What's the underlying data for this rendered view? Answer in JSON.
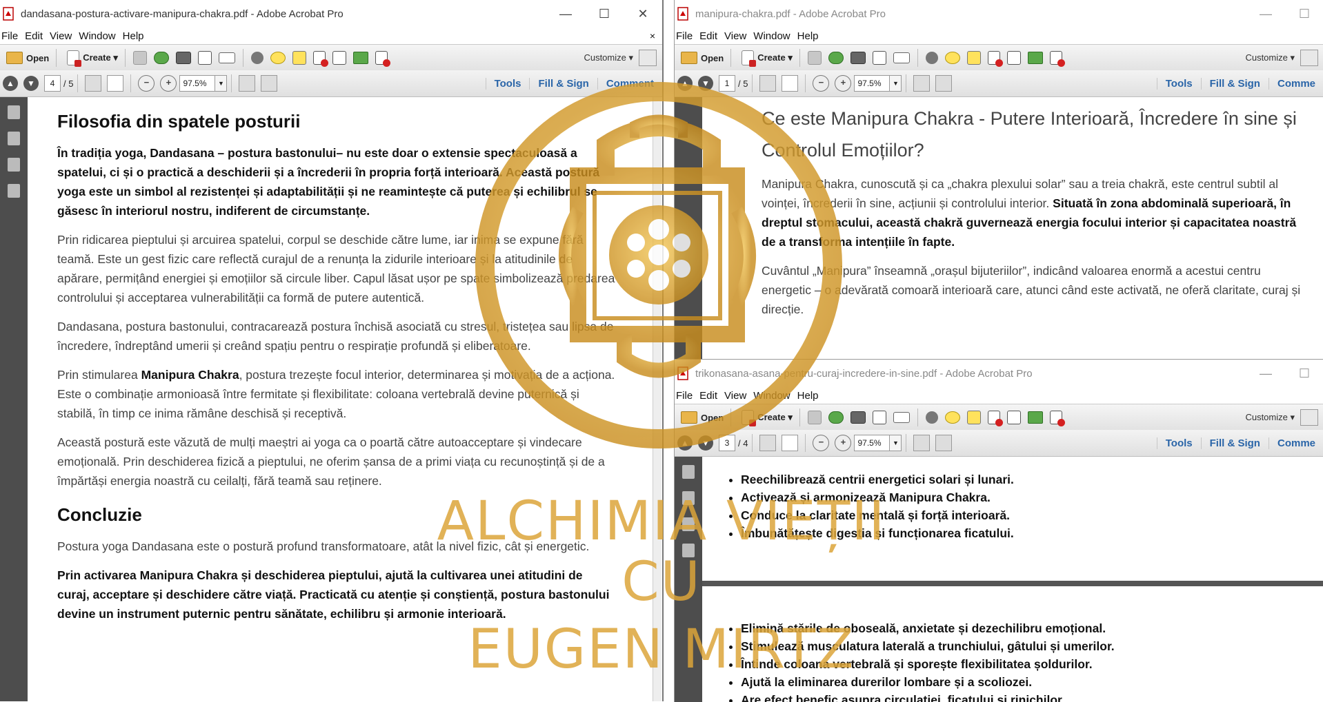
{
  "window_left": {
    "title": "dandasana-postura-activare-manipura-chakra.pdf - Adobe Acrobat Pro",
    "minimize": "—",
    "maximize": "☐",
    "close": "✕",
    "menu": [
      "File",
      "Edit",
      "View",
      "Window",
      "Help"
    ],
    "menu_close": "×",
    "toolbar": {
      "open_label": "Open",
      "create_label": "Create ▾",
      "customize_label": "Customize ▾"
    },
    "nav": {
      "page": "4",
      "of": "/ 5",
      "zoom": "97.5%"
    },
    "tabs": [
      "Tools",
      "Fill & Sign",
      "Comment"
    ],
    "content": {
      "heading1": "Filosofia din spatele posturii",
      "p1": "În tradiția yoga, Dandasana – postura bastonului– nu este doar o extensie spectaculoasă a spatelui, ci și o practică a deschiderii și a încrederii în propria forță interioară. Această postură yoga este un simbol al rezistenței și adaptabilității și ne reamintește că puterea și echilibrul se găsesc în interiorul nostru, indiferent de circumstanțe.",
      "p2": "Prin ridicarea pieptului și arcuirea spatelui, corpul se deschide către lume, iar inima se expune fără teamă. Este un gest fizic care reflectă curajul de a renunța la zidurile interioare și la atitudinile de apărare, permițând energiei și emoțiilor să circule liber. Capul lăsat ușor pe spate simbolizează predarea controlului și acceptarea vulnerabilității ca formă de putere autentică.",
      "p3": "Dandasana, postura bastonului, contracarează postura închisă asociată cu stresul, tristețea sau lipsa de încredere, îndreptând umerii și creând spațiu pentru o respirație profundă și eliberatoare.",
      "p4_a": "Prin stimularea ",
      "p4_b": "Manipura Chakra",
      "p4_c": ", postura trezește focul interior, determinarea și motivația de a acționa. Este o combinație armonioasă între fermitate și flexibilitate: coloana vertebrală devine puternică și stabilă, în timp ce inima rămâne deschisă și receptivă.",
      "p5": "Această postură este văzută de mulți maeștri ai yoga ca o poartă către autoacceptare și vindecare emoțională. Prin deschiderea fizică a pieptului, ne oferim șansa de a primi viața cu recunoștință și de a împărtăși energia noastră cu ceilalți, fără teamă sau reținere.",
      "heading2": "Concluzie",
      "p6": "Postura yoga Dandasana este o postură profund transformatoare, atât la nivel fizic, cât și energetic.",
      "p7": "Prin activarea Manipura Chakra și deschiderea pieptului, ajută la cultivarea unei atitudini de curaj, acceptare și deschidere către viață. Practicată cu atenție și conștiență, postura bastonului devine un instrument puternic pentru sănătate, echilibru și armonie interioară."
    }
  },
  "window_top_right": {
    "title": "manipura-chakra.pdf - Adobe Acrobat Pro",
    "minimize": "—",
    "maximize": "☐",
    "menu": [
      "File",
      "Edit",
      "View",
      "Window",
      "Help"
    ],
    "toolbar": {
      "open_label": "Open",
      "create_label": "Create ▾",
      "customize_label": "Customize ▾"
    },
    "nav": {
      "page": "1",
      "of": "/ 5",
      "zoom": "97.5%"
    },
    "tabs": [
      "Tools",
      "Fill & Sign",
      "Comme"
    ],
    "content": {
      "heading": "Ce este Manipura Chakra - Putere Interioară, Încredere în sine și Controlul Emoțiilor?",
      "p1_a": "Manipura Chakra, cunoscută și ca „chakra plexului solar” sau a treia chakră, este centrul subtil al voinței, încrederii în sine, acțiunii și controlului interior. ",
      "p1_b": "Situată în zona abdominală superioară, în dreptul stomacului, această chakră guvernează energia focului interior și capacitatea noastră de a transforma intențiile în fapte.",
      "p2": "Cuvântul „Manipura” înseamnă „orașul bijuteriilor”, indicând valoarea enormă a acestui centru energetic – o adevărată comoară interioară care, atunci când este activată, ne oferă claritate, curaj și direcție."
    }
  },
  "window_bottom_right": {
    "title": "trikonasana-asana-pentru-curaj-incredere-in-sine.pdf - Adobe Acrobat Pro",
    "minimize": "—",
    "maximize": "☐",
    "menu": [
      "File",
      "Edit",
      "View",
      "Window",
      "Help"
    ],
    "toolbar": {
      "open_label": "Open",
      "create_label": "Create ▾",
      "customize_label": "Customize ▾"
    },
    "nav": {
      "page": "3",
      "of": "/ 4",
      "zoom": "97.5%"
    },
    "tabs": [
      "Tools",
      "Fill & Sign",
      "Comme"
    ],
    "list1": [
      "Reechilibrează centrii energetici solari și lunari.",
      "Activează și armonizează Manipura Chakra.",
      "Conduce la claritate mentală și forță interioară.",
      "Îmbunătățește digestia și funcționarea ficatului."
    ],
    "list2": [
      "Elimină stările de oboseală, anxietate și dezechilibru emoțional.",
      "Stimulează musculatura laterală a trunchiului, gâtului și umerilor.",
      "Întinde coloana vertebrală și sporește flexibilitatea șoldurilor.",
      "Ajută la eliminarea durerilor lombare și a scoliozei.",
      "Are efect benefic asupra circulației, ficatului și rinichilor."
    ]
  },
  "watermark": {
    "line1": "ALCHIMIA VIEȚII",
    "line2": "CU",
    "line3": "EUGEN MIRTZ",
    "color": "#dca53a"
  }
}
